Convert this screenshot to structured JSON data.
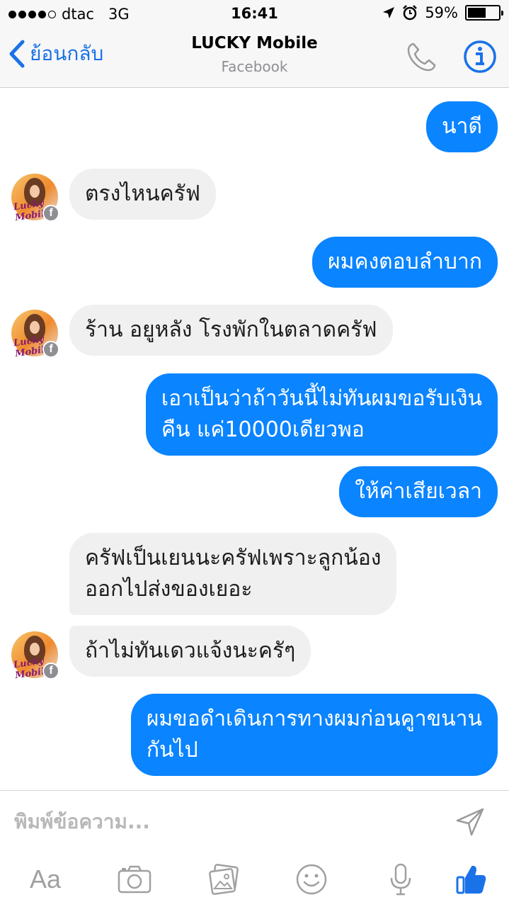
{
  "status_bar": {
    "carrier": "dtac",
    "network": "3G",
    "time": "16:41",
    "battery": "59%",
    "battery_level": 0.59
  },
  "nav": {
    "back_label": "ย้อนกลับ",
    "title": "LUCKY Mobile",
    "subtitle": "Facebook"
  },
  "contact": {
    "avatar_text": "Lucky Mobile",
    "badge_icon": "f"
  },
  "messages": [
    {
      "side": "out",
      "text": "นาดี"
    },
    {
      "side": "in",
      "text": "ตรงไหนครัฟ"
    },
    {
      "side": "out",
      "text": "ผมคงตอบลำบาก"
    },
    {
      "side": "in",
      "text": "ร้าน อยูหลัง โรงพักในตลาดครัฟ"
    },
    {
      "side": "out",
      "text": "เอาเป็นว่าถ้าวันนี้ไม่ทันผมขอรับเงิน",
      "text2": "คืน แค่10000เดียวพอ"
    },
    {
      "side": "out",
      "text": "ให้ค่าเสียเวลา"
    },
    {
      "side": "in",
      "text": "ครัฟเป็นเยนนะครัฟเพราะลูกน้อง",
      "text2": "ออกไปส่งของเยอะ"
    },
    {
      "side": "in",
      "text": "ถ้าไม่ทันเดวแจ้งนะครัๆ"
    },
    {
      "side": "out",
      "text": "ผมขอดำเดินการทางผมก่อนคูาขนาน",
      "text2": "กันไป"
    }
  ],
  "composer": {
    "placeholder": "พิมพ์ข้อความ...",
    "aa_label": "Aa"
  },
  "colors": {
    "accent": "#1a72e8",
    "outgoing_bubble": "#0a84ff",
    "incoming_bubble": "#f1f0f0"
  }
}
